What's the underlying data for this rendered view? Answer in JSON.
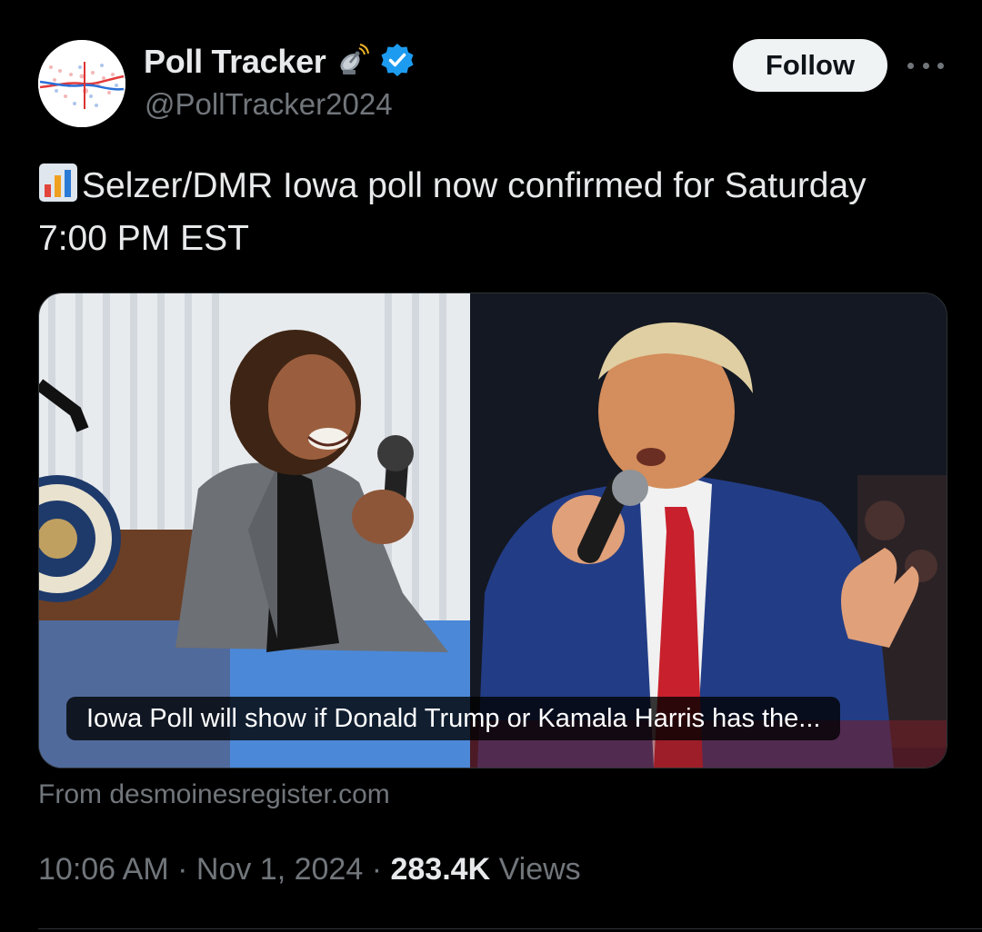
{
  "author": {
    "display_name": "Poll Tracker",
    "name_icon": "satellite-antenna-icon",
    "verified": "verified-badge-icon",
    "handle": "@PollTracker2024"
  },
  "actions": {
    "follow_label": "Follow",
    "more_icon": "more-options-icon"
  },
  "tweet": {
    "emoji": "bar-chart-icon",
    "text_line1": "Selzer/DMR Iowa poll now confirmed for Saturday",
    "text_line2": "7:00 PM EST"
  },
  "link_card": {
    "caption": "Iowa Poll will show if Donald Trump or Kamala Harris has the...",
    "source": "From desmoinesregister.com"
  },
  "meta": {
    "time": "10:06 AM",
    "separator": "·",
    "date": "Nov 1, 2024",
    "views_count": "283.4K",
    "views_label": "Views"
  },
  "colors": {
    "background": "#000000",
    "primary_text": "#e7e9ea",
    "secondary_text": "#71767b",
    "verified_blue": "#1d9bf0",
    "follow_bg": "#eff3f4"
  }
}
